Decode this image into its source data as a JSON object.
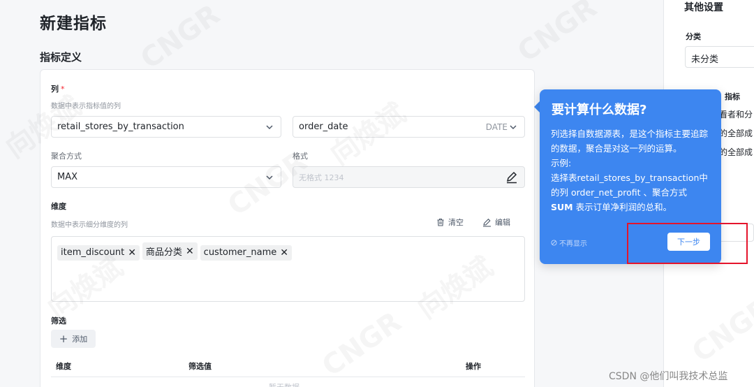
{
  "page": {
    "title": "新建指标"
  },
  "definition": {
    "section_title": "指标定义",
    "column": {
      "label": "列",
      "required_mark": "*",
      "hint": "数据中表示指标值的列",
      "table_value": "retail_stores_by_transaction",
      "date_value": "order_date",
      "date_type": "DATE"
    },
    "aggregation": {
      "label": "聚合方式",
      "value": "MAX"
    },
    "format": {
      "label": "格式",
      "placeholder": "无格式 1234"
    },
    "dimensions": {
      "label": "维度",
      "hint": "数据中表示细分维度的列",
      "clear_label": "清空",
      "edit_label": "编辑",
      "tags": [
        "item_discount",
        "商品分类",
        "customer_name"
      ]
    },
    "filter": {
      "label": "筛选",
      "add_label": "添加",
      "columns": [
        "维度",
        "筛选值",
        "操作"
      ],
      "empty_text": "暂无数据"
    }
  },
  "side_panel": {
    "title": "其他设置",
    "category_label": "分类",
    "category_value": "未分类",
    "fragments": [
      "指标",
      "看者和分",
      "的全部成",
      "的全部成"
    ]
  },
  "popover": {
    "title": "要计算什么数据?",
    "body_line1": "列选择自数据源表，是这个指标主要追踪的数据，聚合是对这一列的运算。",
    "body_line2": "示例:",
    "body_line3": "选择表retail_stores_by_transaction中的列 order_net_profit 、聚合方式",
    "body_sum": "SUM",
    "body_line4": " 表示订单净利润的总和。",
    "skip_label": "不再显示",
    "next_label": "下一步"
  },
  "watermarks": [
    "CNGR",
    "向焕斌"
  ],
  "footer": {
    "credit": "CSDN @他们叫我技术总监"
  },
  "colors": {
    "accent": "#3d86f0",
    "highlight": "#e5142b",
    "required": "#f5222d"
  }
}
